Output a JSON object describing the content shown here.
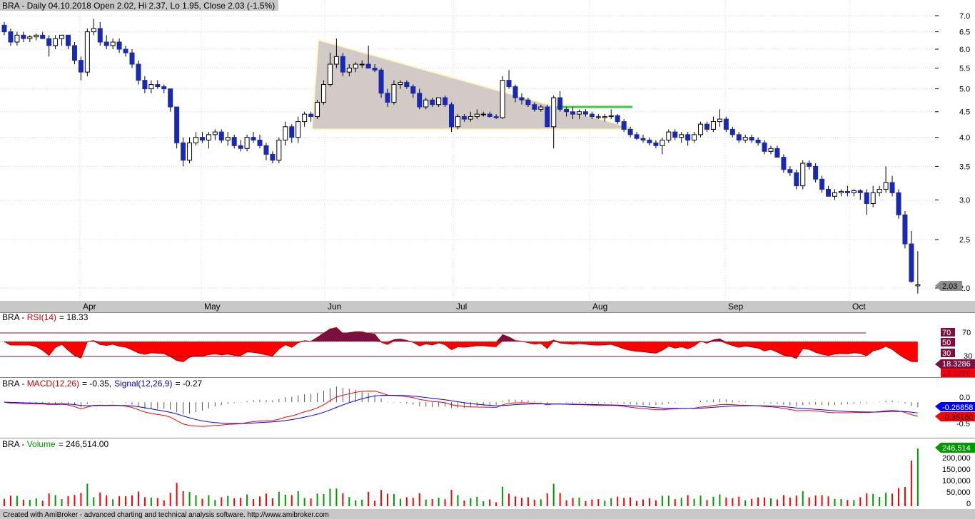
{
  "app": {
    "footer": "Created with AmiBroker - advanced charting and technical analysis software. http://www.amibroker.com"
  },
  "price_pane": {
    "title": "BRA - Daily 04.10.2018 Open 2.02, Hi 2.37, Lo 1.95, Close 2.03 (-1.5%)",
    "last_label": "2.03",
    "y_ticks": [
      "7.0",
      "6.5",
      "6.0",
      "5.5",
      "5.0",
      "4.5",
      "4.0",
      "3.5",
      "3.0",
      "2.5",
      "2.0"
    ],
    "months": [
      "Apr",
      "May",
      "Jun",
      "Jul",
      "Aug",
      "Sep",
      "Oct"
    ]
  },
  "rsi_pane": {
    "name": "BRA",
    "indicator": "RSI(14)",
    "value_text": "= 18.33",
    "levels": [
      "70",
      "50",
      "30"
    ],
    "axis_labels": [
      "70",
      "30"
    ],
    "value_badges": [
      "18.3286",
      "18.3286"
    ]
  },
  "macd_pane": {
    "name": "BRA",
    "macd_label": "MACD(12,26)",
    "macd_value": "= -0.35,",
    "signal_label": "Signal(12,26,9)",
    "signal_value": "= -0.27",
    "axis_labels": [
      "0.0",
      "-0.5"
    ],
    "signal_badge": "-0.26858",
    "macd_badge": "-0.35160"
  },
  "volume_pane": {
    "name": "BRA",
    "label": "Volume",
    "value_text": "= 246,514.00",
    "badge": "246,514",
    "axis_labels": [
      "200,000",
      "150,000",
      "100,000",
      "50,000",
      "0"
    ]
  },
  "colors": {
    "up": "#ffffff",
    "down": "#1a2ab0",
    "rsi_fill": "#ff0000",
    "rsi_over": "#7a1040",
    "macd": "#ff0000",
    "signal": "#0000ff",
    "vol_up": "#009900",
    "vol_down": "#ff0000",
    "annotation": "#3cc93c",
    "triangle_fill": "#d2cac6"
  },
  "chart_data": [
    {
      "type": "candlestick",
      "title": "BRA - Daily 04.10.2018 Open 2.02, Hi 2.37, Lo 1.95, Close 2.03 (-1.5%)",
      "y_scale": "log",
      "ylim": [
        1.95,
        7.2
      ],
      "x_months": [
        "Apr",
        "May",
        "Jun",
        "Jul",
        "Aug",
        "Sep",
        "Oct"
      ],
      "candles": [
        [
          6.7,
          6.8,
          6.4,
          6.5
        ],
        [
          6.5,
          6.6,
          6.1,
          6.2
        ],
        [
          6.2,
          6.5,
          6.1,
          6.4
        ],
        [
          6.4,
          6.5,
          6.2,
          6.3
        ],
        [
          6.3,
          6.4,
          6.2,
          6.35
        ],
        [
          6.35,
          6.45,
          6.25,
          6.4
        ],
        [
          6.4,
          6.5,
          6.3,
          6.3
        ],
        [
          6.3,
          6.4,
          5.8,
          6.1
        ],
        [
          6.1,
          6.4,
          6.0,
          6.3
        ],
        [
          6.3,
          6.4,
          6.1,
          6.4
        ],
        [
          6.4,
          6.4,
          6.0,
          6.1
        ],
        [
          6.1,
          6.2,
          5.6,
          5.7
        ],
        [
          5.7,
          5.8,
          5.2,
          5.4
        ],
        [
          5.4,
          6.6,
          5.3,
          6.5
        ],
        [
          6.5,
          6.9,
          6.4,
          6.6
        ],
        [
          6.6,
          6.8,
          6.1,
          6.2
        ],
        [
          6.2,
          6.4,
          6.0,
          6.1
        ],
        [
          6.1,
          6.3,
          6.0,
          6.2
        ],
        [
          6.2,
          6.3,
          5.9,
          6.0
        ],
        [
          6.0,
          6.1,
          5.8,
          5.9
        ],
        [
          5.9,
          6.0,
          5.5,
          5.6
        ],
        [
          5.6,
          5.7,
          5.1,
          5.2
        ],
        [
          5.2,
          5.3,
          4.9,
          5.0
        ],
        [
          5.0,
          5.2,
          4.9,
          5.1
        ],
        [
          5.1,
          5.2,
          5.0,
          5.05
        ],
        [
          5.05,
          5.1,
          4.9,
          5.0
        ],
        [
          5.0,
          5.0,
          4.5,
          4.6
        ],
        [
          4.6,
          4.6,
          3.8,
          3.9
        ],
        [
          3.9,
          4.0,
          3.5,
          3.6
        ],
        [
          3.6,
          4.0,
          3.55,
          3.9
        ],
        [
          3.9,
          4.1,
          3.85,
          4.0
        ],
        [
          4.0,
          4.1,
          3.9,
          3.95
        ],
        [
          3.95,
          4.1,
          3.8,
          4.05
        ],
        [
          4.05,
          4.15,
          3.95,
          4.1
        ],
        [
          4.1,
          4.15,
          3.9,
          3.95
        ],
        [
          3.95,
          4.1,
          3.85,
          4.0
        ],
        [
          4.0,
          4.05,
          3.8,
          3.85
        ],
        [
          3.85,
          3.95,
          3.75,
          3.8
        ],
        [
          3.8,
          4.05,
          3.75,
          4.0
        ],
        [
          4.0,
          4.1,
          3.9,
          3.95
        ],
        [
          3.95,
          4.05,
          3.8,
          3.85
        ],
        [
          3.85,
          3.9,
          3.6,
          3.7
        ],
        [
          3.7,
          3.75,
          3.55,
          3.6
        ],
        [
          3.6,
          4.0,
          3.55,
          3.95
        ],
        [
          3.95,
          4.3,
          3.85,
          4.2
        ],
        [
          4.2,
          4.25,
          3.9,
          4.0
        ],
        [
          4.0,
          4.4,
          3.9,
          4.3
        ],
        [
          4.3,
          4.5,
          4.2,
          4.45
        ],
        [
          4.45,
          4.5,
          4.3,
          4.4
        ],
        [
          4.4,
          4.75,
          4.35,
          4.7
        ],
        [
          4.7,
          5.2,
          4.65,
          5.1
        ],
        [
          5.1,
          5.9,
          5.05,
          5.6
        ],
        [
          5.6,
          6.3,
          5.5,
          5.8
        ],
        [
          5.8,
          5.9,
          5.3,
          5.4
        ],
        [
          5.4,
          5.6,
          5.3,
          5.5
        ],
        [
          5.5,
          5.65,
          5.4,
          5.6
        ],
        [
          5.6,
          5.7,
          5.5,
          5.6
        ],
        [
          5.6,
          6.1,
          5.5,
          5.5
        ],
        [
          5.5,
          5.6,
          5.4,
          5.45
        ],
        [
          5.45,
          5.5,
          4.8,
          4.9
        ],
        [
          4.9,
          5.0,
          4.6,
          4.7
        ],
        [
          4.7,
          5.2,
          4.65,
          5.1
        ],
        [
          5.1,
          5.2,
          5.0,
          5.15
        ],
        [
          5.15,
          5.2,
          5.0,
          5.05
        ],
        [
          5.05,
          5.1,
          4.8,
          4.9
        ],
        [
          4.9,
          5.0,
          4.55,
          4.6
        ],
        [
          4.6,
          4.8,
          4.55,
          4.75
        ],
        [
          4.75,
          4.8,
          4.6,
          4.65
        ],
        [
          4.65,
          4.8,
          4.6,
          4.8
        ],
        [
          4.8,
          4.85,
          4.6,
          4.65
        ],
        [
          4.65,
          4.7,
          4.1,
          4.2
        ],
        [
          4.2,
          4.45,
          4.15,
          4.4
        ],
        [
          4.4,
          4.45,
          4.3,
          4.35
        ],
        [
          4.35,
          4.5,
          4.3,
          4.4
        ],
        [
          4.4,
          4.55,
          4.35,
          4.45
        ],
        [
          4.45,
          4.5,
          4.4,
          4.45
        ],
        [
          4.45,
          4.5,
          4.38,
          4.4
        ],
        [
          4.4,
          4.45,
          4.35,
          4.38
        ],
        [
          4.38,
          5.3,
          4.35,
          5.2
        ],
        [
          5.2,
          5.45,
          5.0,
          5.05
        ],
        [
          5.05,
          5.1,
          4.7,
          4.8
        ],
        [
          4.8,
          4.9,
          4.65,
          4.75
        ],
        [
          4.75,
          4.8,
          4.6,
          4.65
        ],
        [
          4.65,
          4.7,
          4.5,
          4.55
        ],
        [
          4.55,
          4.65,
          4.5,
          4.6
        ],
        [
          4.6,
          4.65,
          4.3,
          4.2
        ],
        [
          4.2,
          4.85,
          3.8,
          4.8
        ],
        [
          4.8,
          4.95,
          4.5,
          4.55
        ],
        [
          4.55,
          4.6,
          4.4,
          4.5
        ],
        [
          4.5,
          4.6,
          4.35,
          4.45
        ],
        [
          4.45,
          4.55,
          4.35,
          4.5
        ],
        [
          4.5,
          4.55,
          4.4,
          4.45
        ],
        [
          4.45,
          4.5,
          4.35,
          4.4
        ],
        [
          4.4,
          4.45,
          4.35,
          4.38
        ],
        [
          4.38,
          4.45,
          4.3,
          4.4
        ],
        [
          4.4,
          4.55,
          4.35,
          4.42
        ],
        [
          4.42,
          4.45,
          4.25,
          4.3
        ],
        [
          4.3,
          4.35,
          4.1,
          4.15
        ],
        [
          4.15,
          4.2,
          4.0,
          4.05
        ],
        [
          4.05,
          4.1,
          3.95,
          3.98
        ],
        [
          3.98,
          4.05,
          3.9,
          3.95
        ],
        [
          3.95,
          4.0,
          3.85,
          3.9
        ],
        [
          3.9,
          3.95,
          3.8,
          3.85
        ],
        [
          3.85,
          4.0,
          3.7,
          3.95
        ],
        [
          3.95,
          4.15,
          3.9,
          4.1
        ],
        [
          4.1,
          4.15,
          3.95,
          4.0
        ],
        [
          4.0,
          4.1,
          3.9,
          4.05
        ],
        [
          4.05,
          4.1,
          3.85,
          3.95
        ],
        [
          3.95,
          4.1,
          3.9,
          4.05
        ],
        [
          4.05,
          4.3,
          4.0,
          4.25
        ],
        [
          4.25,
          4.3,
          4.1,
          4.15
        ],
        [
          4.15,
          4.4,
          4.1,
          4.3
        ],
        [
          4.3,
          4.55,
          4.2,
          4.35
        ],
        [
          4.35,
          4.4,
          4.1,
          4.15
        ],
        [
          4.15,
          4.2,
          4.0,
          4.05
        ],
        [
          4.05,
          4.1,
          3.9,
          3.95
        ],
        [
          3.95,
          4.05,
          3.9,
          4.0
        ],
        [
          4.0,
          4.05,
          3.9,
          3.95
        ],
        [
          3.95,
          4.0,
          3.85,
          3.9
        ],
        [
          3.9,
          3.95,
          3.7,
          3.75
        ],
        [
          3.75,
          3.85,
          3.7,
          3.8
        ],
        [
          3.8,
          3.85,
          3.65,
          3.65
        ],
        [
          3.65,
          3.7,
          3.4,
          3.45
        ],
        [
          3.45,
          3.5,
          3.35,
          3.4
        ],
        [
          3.4,
          3.45,
          3.15,
          3.2
        ],
        [
          3.2,
          3.6,
          3.15,
          3.55
        ],
        [
          3.55,
          3.6,
          3.45,
          3.5
        ],
        [
          3.5,
          3.55,
          3.25,
          3.3
        ],
        [
          3.3,
          3.35,
          3.1,
          3.15
        ],
        [
          3.15,
          3.2,
          3.05,
          3.05
        ],
        [
          3.05,
          3.15,
          3.0,
          3.1
        ],
        [
          3.1,
          3.15,
          3.05,
          3.12
        ],
        [
          3.12,
          3.2,
          3.05,
          3.1
        ],
        [
          3.1,
          3.15,
          3.05,
          3.13
        ],
        [
          3.13,
          3.15,
          3.0,
          3.1
        ],
        [
          3.1,
          3.15,
          2.8,
          2.95
        ],
        [
          2.95,
          3.2,
          2.9,
          3.1
        ],
        [
          3.1,
          3.2,
          3.05,
          3.15
        ],
        [
          3.15,
          3.5,
          3.1,
          3.25
        ],
        [
          3.25,
          3.35,
          3.05,
          3.1
        ],
        [
          3.1,
          3.15,
          2.75,
          2.8
        ],
        [
          2.8,
          2.85,
          2.4,
          2.45
        ],
        [
          2.45,
          2.6,
          2.05,
          2.06
        ],
        [
          2.02,
          2.37,
          1.95,
          2.03
        ]
      ],
      "triangle": [
        [
          "~Jun-1",
          6.3
        ],
        [
          "~Aug-8",
          4.15
        ],
        [
          "~May-31",
          4.15
        ]
      ],
      "hline": {
        "from": "~Jul-25",
        "to": "~Aug-8",
        "y": 4.6
      }
    },
    {
      "type": "area",
      "title": "BRA - RSI(14) = 18.33",
      "ylim": [
        10,
        80
      ],
      "levels": [
        70,
        50,
        30
      ],
      "last": 18.33
    },
    {
      "type": "line",
      "title": "BRA - MACD(12,26) = -0.35, Signal(12,26,9) = -0.27",
      "series": [
        {
          "name": "MACD(12,26)",
          "color": "#ff0000"
        },
        {
          "name": "Signal(12,26,9)",
          "color": "#0000ff"
        }
      ],
      "macd_last": -0.35,
      "signal_last": -0.27
    },
    {
      "type": "bar",
      "title": "BRA - Volume = 246,514.00",
      "ylim": [
        0,
        250000
      ],
      "last": 246514
    }
  ]
}
